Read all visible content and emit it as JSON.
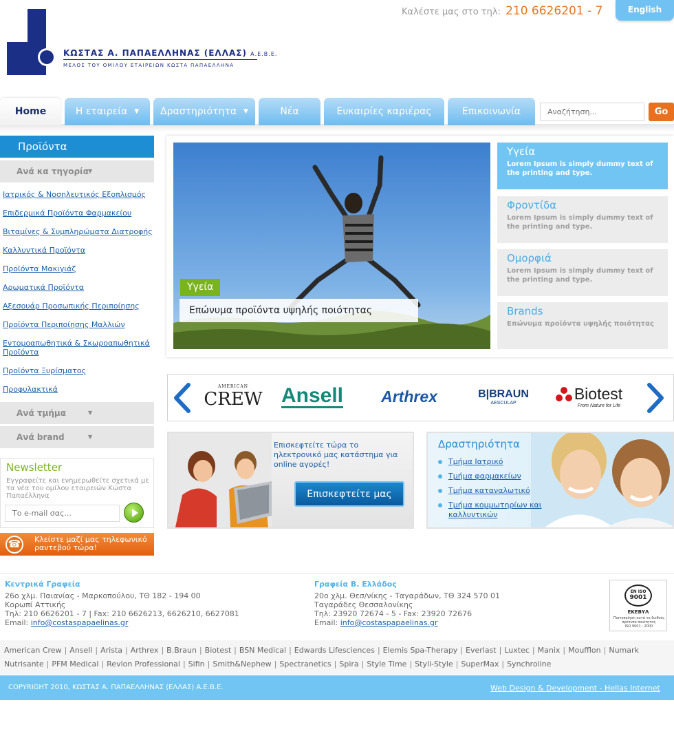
{
  "header": {
    "company_name": "ΚΩΣΤΑΣ Α. ΠΑΠΑΕΛΛΗΝΑΣ (ΕΛΛΑΣ)",
    "company_suffix": "Α.Ε.Β.Ε.",
    "company_tagline": "ΜΕΛΟΣ ΤΟΥ ΟΜΙΛΟΥ ΕΤΑΙΡΕΙΩΝ ΚΩΣΤΑ ΠΑΠΑΕΛΛΗΝΑ",
    "call_label": "Καλέστε μας στο τηλ:",
    "call_number": "210 6626201 - 7",
    "language_button": "English"
  },
  "nav": {
    "tabs": [
      {
        "label": "Home"
      },
      {
        "label": "Η εταιρεία"
      },
      {
        "label": "Δραστηριότητα"
      },
      {
        "label": "Νέα"
      },
      {
        "label": "Ευκαιρίες καριέρας"
      },
      {
        "label": "Επικοινωνία"
      }
    ],
    "search_placeholder": "Αναζήτηση...",
    "search_button": "Go"
  },
  "sidebar": {
    "title": "Προϊόντα",
    "by_category": "Ανά κα τηγορία",
    "categories": [
      "Ιατρικός & Νοσηλευτικός Εξοπλισμός",
      "Επιδερμικά Προϊόντα Φαρμακείου",
      "Βιταμίνες & Συμπληρώματα Διατροφής",
      "Καλλυντικά Προϊόντα",
      "Προϊόντα Μακιγιάζ",
      "Αρωματικά Προϊόντα",
      "Αξεσουάρ Προσωπικής Περιποίησης",
      "Προϊόντα Περιποίησης Μαλλιών",
      "Εντομοαπωθητικά & Σκωροαπωθητικά Προϊόντα",
      "Προϊόντα Ξυρίσματος",
      "Προφυλακτικά"
    ],
    "by_department": "Ανά τμήμα",
    "by_brand": "Ανά brand",
    "newsletter": {
      "title": "Newsletter",
      "text": "Εγγραφείτε και ενημερωθείτε σχετικά με τα νέα του ομίλου εταιρειών Κώστα Παπαέλληνα",
      "placeholder": "Το e-mail σας..."
    },
    "appointment": "Κλείστε μαζί μας τηλεφωνικό ραντεβού τώρα!"
  },
  "hero": {
    "label": "Υγεία",
    "caption": "Επώνυμα προϊόντα υψηλής ποιότητας",
    "features": [
      {
        "title": "Υγεία",
        "desc": "Lorem Ipsum is simply dummy text of the printing and type."
      },
      {
        "title": "Φροντίδα",
        "desc": "Lorem Ipsum is simply dummy text of the printing and type."
      },
      {
        "title": "Ομορφιά",
        "desc": "Lorem Ipsum is simply dummy text of the printing and type."
      },
      {
        "title": "Brands",
        "desc": "Επώνυμα προϊόντα υψηλής ποιότητας"
      }
    ]
  },
  "brand_logos": {
    "crew_top": "AMERICAN",
    "crew": "CREW",
    "ansell": "Ansell",
    "arthrex": "Arthrex",
    "bbraun": "B|BRAUN",
    "bbraun_sub": "AESCULAP",
    "biotest": "Biotest",
    "biotest_sub": "From Nature for Life"
  },
  "promo": {
    "text": "Επισκεφτείτε τώρα το ηλεκτρονικό μας κατάστημα για online αγορές!",
    "button": "Επισκεφτείτε μας"
  },
  "activity": {
    "title": "Δραστηριότητα",
    "items": [
      "Τμήμα Ιατρικό",
      "Τμήμα φαρμακείων",
      "Τμήμα καταναλωτικό",
      "Τμήμα κομμωτηρίων και καλλυντικών"
    ]
  },
  "footer": {
    "office1": {
      "title": "Κεντρικά Γραφεία",
      "line1": "26ο χλμ. Παιανίας - Μαρκοπούλου, ΤΘ 182 - 194 00",
      "line2": "Κορωπί Αττικής",
      "line3": "Τηλ: 210 6626201 - 7 | Fax: 210 6626213, 6626210, 6627081",
      "email_label": "Email:",
      "email": "info@costaspapaelinas.gr"
    },
    "office2": {
      "title": "Γραφεία Β. Ελλάδος",
      "line1": "20ο χλμ. Θεσ/νίκης - Ταγαράδων, ΤΘ 324 570 01",
      "line2": "Ταγαράδες Θεσσαλονίκης",
      "line3": "Τηλ: 23920 72674 - 5 - Fax: 23920 72676",
      "email_label": "Email:",
      "email": "info@costaspapaelinas.gr"
    },
    "iso": {
      "top": "EN ISO",
      "num": "9001",
      "org": "ΕΚΕΒΥΛ",
      "line1": "Πιστοποίηση κατά το διεθνές",
      "line2": "πρότυπο ποιότητας",
      "line3": "ISO 9001 : 2000"
    },
    "brands": [
      "American Crew",
      "Ansell",
      "Arista",
      "Arthrex",
      "B.Braun",
      "Biotest",
      "BSN Medical",
      "Edwards Lifesciences",
      "Elemis Spa-Therapy",
      "Everlast",
      "Luxtec",
      "Manix",
      "Moufflon",
      "Numark",
      "Nutrisante",
      "PFM Medical",
      "Revlon Professional",
      "Sifin",
      "Smith&Nephew",
      "Spectranetics",
      "Spira",
      "Style Time",
      "Styli-Style",
      "SuperMax",
      "Synchroline"
    ],
    "copyright": "COPYRIGHT 2010, ΚΩΣΤΑΣ Α. ΠΑΠΑΕΛΛΗΝΑΣ (ΕΛΛΑΣ) Α.Ε.Β.Ε.",
    "credit": "Web Design & Development - Hellas Internet"
  }
}
